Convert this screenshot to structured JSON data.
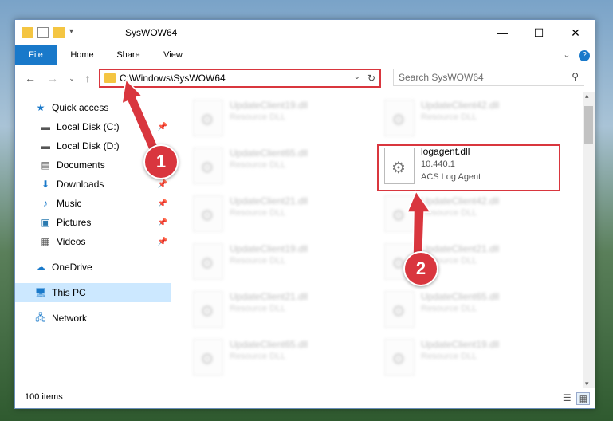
{
  "window": {
    "title": "SysWOW64"
  },
  "ribbon": {
    "tabs": [
      "File",
      "Home",
      "Share",
      "View"
    ]
  },
  "address": {
    "path": "C:\\Windows\\SysWOW64"
  },
  "search": {
    "placeholder": "Search SysWOW64"
  },
  "sidebar": {
    "items": [
      {
        "label": "Quick access",
        "icon": "star-icon"
      },
      {
        "label": "Local Disk (C:)",
        "icon": "disk-icon"
      },
      {
        "label": "Local Disk (D:)",
        "icon": "disk-icon"
      },
      {
        "label": "Documents",
        "icon": "documents-icon"
      },
      {
        "label": "Downloads",
        "icon": "download-icon"
      },
      {
        "label": "Music",
        "icon": "music-icon"
      },
      {
        "label": "Pictures",
        "icon": "pictures-icon"
      },
      {
        "label": "Videos",
        "icon": "videos-icon"
      },
      {
        "label": "OneDrive",
        "icon": "cloud-icon"
      },
      {
        "label": "This PC",
        "icon": "computer-icon"
      },
      {
        "label": "Network",
        "icon": "network-icon"
      }
    ]
  },
  "files": {
    "col1": [
      {
        "name": "UpdateClient19.dll",
        "desc": "Resource DLL"
      },
      {
        "name": "UpdateClient65.dll",
        "desc": "Resource DLL"
      },
      {
        "name": "UpdateClient21.dll",
        "desc": "Resource DLL"
      },
      {
        "name": "UpdateClient19.dll",
        "desc": "Resource DLL"
      },
      {
        "name": "UpdateClient21.dll",
        "desc": "Resource DLL"
      },
      {
        "name": "UpdateClient65.dll",
        "desc": "Resource DLL"
      }
    ],
    "col2": [
      {
        "name": "UpdateClient42.dll",
        "desc": "Resource DLL"
      },
      {
        "name": "logagent.dll",
        "version": "10.440.1",
        "desc": "ACS Log Agent"
      },
      {
        "name": "UpdateClient42.dll",
        "desc": "Resource DLL"
      },
      {
        "name": "UpdateClient21.dll",
        "desc": "Resource DLL"
      },
      {
        "name": "UpdateClient65.dll",
        "desc": "Resource DLL"
      },
      {
        "name": "UpdateClient19.dll",
        "desc": "Resource DLL"
      }
    ]
  },
  "status": {
    "count": "100 items"
  },
  "markers": [
    "1",
    "2"
  ],
  "colors": {
    "accent": "#1979ca",
    "highlight": "#d9363e",
    "selected": "#cce8ff"
  }
}
